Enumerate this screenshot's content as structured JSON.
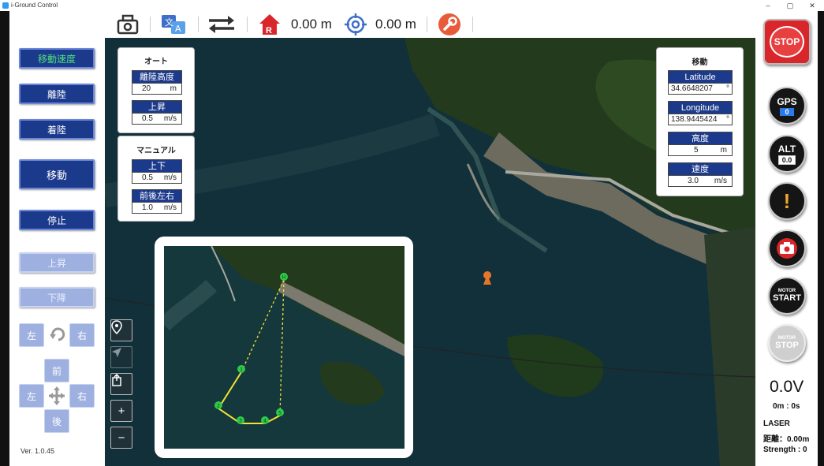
{
  "window": {
    "title": "i-Ground Control",
    "minimize": "–",
    "maximize": "▢",
    "close": "✕"
  },
  "toolbar": {
    "home_distance": "0.00 m",
    "target_distance": "0.00 m",
    "translate_glyph_1": "文",
    "translate_glyph_2": "A",
    "home_letter": "R"
  },
  "left": {
    "buttons": [
      "移動速度",
      "離陸",
      "着陸",
      "移動",
      "停止",
      "上昇",
      "下降"
    ],
    "rotate": {
      "left": "左",
      "right": "右"
    },
    "dpad": {
      "forward": "前",
      "left": "左",
      "right": "右",
      "back": "後"
    },
    "version": "Ver.  1.0.45"
  },
  "auto_panel": {
    "title": "オート",
    "fields": [
      {
        "label": "離陸高度",
        "value": "20",
        "unit": "m"
      },
      {
        "label": "上昇",
        "value": "0.5",
        "unit": "m/s"
      }
    ]
  },
  "manual_panel": {
    "title": "マニュアル",
    "fields": [
      {
        "label": "上下",
        "value": "0.5",
        "unit": "m/s"
      },
      {
        "label": "前後左右",
        "value": "1.0",
        "unit": "m/s"
      }
    ]
  },
  "move_panel": {
    "title": "移動",
    "fields": [
      {
        "label": "Latitude",
        "value": "34.6648207",
        "unit": "°"
      },
      {
        "label": "Longitude",
        "value": "138.9445424",
        "unit": "°"
      },
      {
        "label": "高度",
        "value": "5",
        "unit": "m"
      },
      {
        "label": "速度",
        "value": "3.0",
        "unit": "m/s"
      }
    ]
  },
  "map_controls": {
    "zoom_in": "+",
    "zoom_out": "−"
  },
  "inset": {
    "waypoints": [
      "H",
      "1",
      "2",
      "3",
      "4",
      "5"
    ]
  },
  "right": {
    "stop_label": "STOP",
    "gps": {
      "label": "GPS",
      "value": "0"
    },
    "alt": {
      "label": "ALT",
      "value": "0.0"
    },
    "warning": "!",
    "motor_start": {
      "small": "MOTOR",
      "big": "START"
    },
    "motor_stop": {
      "small": "MOTOR",
      "big": "STOP"
    },
    "voltage": "0.0V",
    "timer": "0m : 0s",
    "laser_title": "LASER",
    "laser_distance": "距離：0.00m",
    "laser_strength": "Strength : 0"
  },
  "colors": {
    "accent": "#1c3a8c",
    "active_text": "#4ee07a",
    "disabled": "#9db0e0",
    "stop_red": "#d8262a",
    "waypoint": "#2ec94a",
    "path": "#f2e233"
  }
}
